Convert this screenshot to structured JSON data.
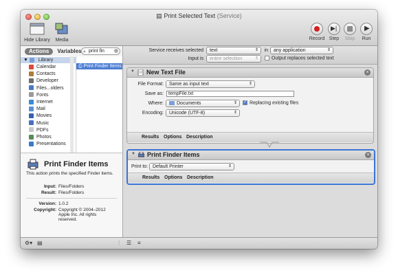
{
  "window": {
    "title": "Print Selected Text",
    "title_suffix": "(Service)"
  },
  "toolbar": {
    "hide_library": "Hide Library",
    "media": "Media",
    "record": "Record",
    "step": "Step",
    "stop": "Stop",
    "run": "Run"
  },
  "library": {
    "actions_tab": "Actions",
    "variables_tab": "Variables",
    "search_value": "print fin",
    "root": "Library",
    "items": [
      {
        "label": "Calendar",
        "color": "#d94b3b"
      },
      {
        "label": "Contacts",
        "color": "#b07a3a"
      },
      {
        "label": "Developer",
        "color": "#6e6e6e"
      },
      {
        "label": "Files...olders",
        "color": "#4a78c8"
      },
      {
        "label": "Fonts",
        "color": "#9a9a9a"
      },
      {
        "label": "Internet",
        "color": "#3a8ad6"
      },
      {
        "label": "Mail",
        "color": "#5b8fd6"
      },
      {
        "label": "Movies",
        "color": "#3a5fb0"
      },
      {
        "label": "Music",
        "color": "#4a6fc0"
      },
      {
        "label": "PDFs",
        "color": "#c8c8c8"
      },
      {
        "label": "Photos",
        "color": "#5a8a5a"
      },
      {
        "label": "Presentations",
        "color": "#3a7ac8"
      }
    ],
    "results": [
      "Print Finder Items"
    ]
  },
  "description": {
    "title": "Print Finder Items",
    "text": "This action prints the specified Finder items.",
    "input_key": "Input:",
    "input_val": "Files/Folders",
    "result_key": "Result:",
    "result_val": "Files/Folders",
    "version_key": "Version:",
    "version_val": "1.0.2",
    "copyright_key": "Copyright:",
    "copyright_val": "Copyright © 2004–2012 Apple Inc.  All rights reserved."
  },
  "service": {
    "receives_label": "Service receives selected",
    "receives_value": "text",
    "in_label": "in",
    "in_value": "any application",
    "input_is_label": "Input is",
    "input_is_value": "entire selection",
    "replaces_label": "Output replaces selected text"
  },
  "action1": {
    "title": "New Text File",
    "file_format_label": "File Format:",
    "file_format_value": "Same as input text",
    "save_as_label": "Save as:",
    "save_as_value": "tempFile.txt",
    "where_label": "Where:",
    "where_value": "Documents",
    "replacing_label": "Replacing existing files",
    "encoding_label": "Encoding:",
    "encoding_value": "Unicode (UTF-8)",
    "tabs": [
      "Results",
      "Options",
      "Description"
    ]
  },
  "action2": {
    "title": "Print Finder Items",
    "print_to_label": "Print to:",
    "print_to_value": "Default Printer",
    "tabs": [
      "Results",
      "Options",
      "Description"
    ]
  }
}
